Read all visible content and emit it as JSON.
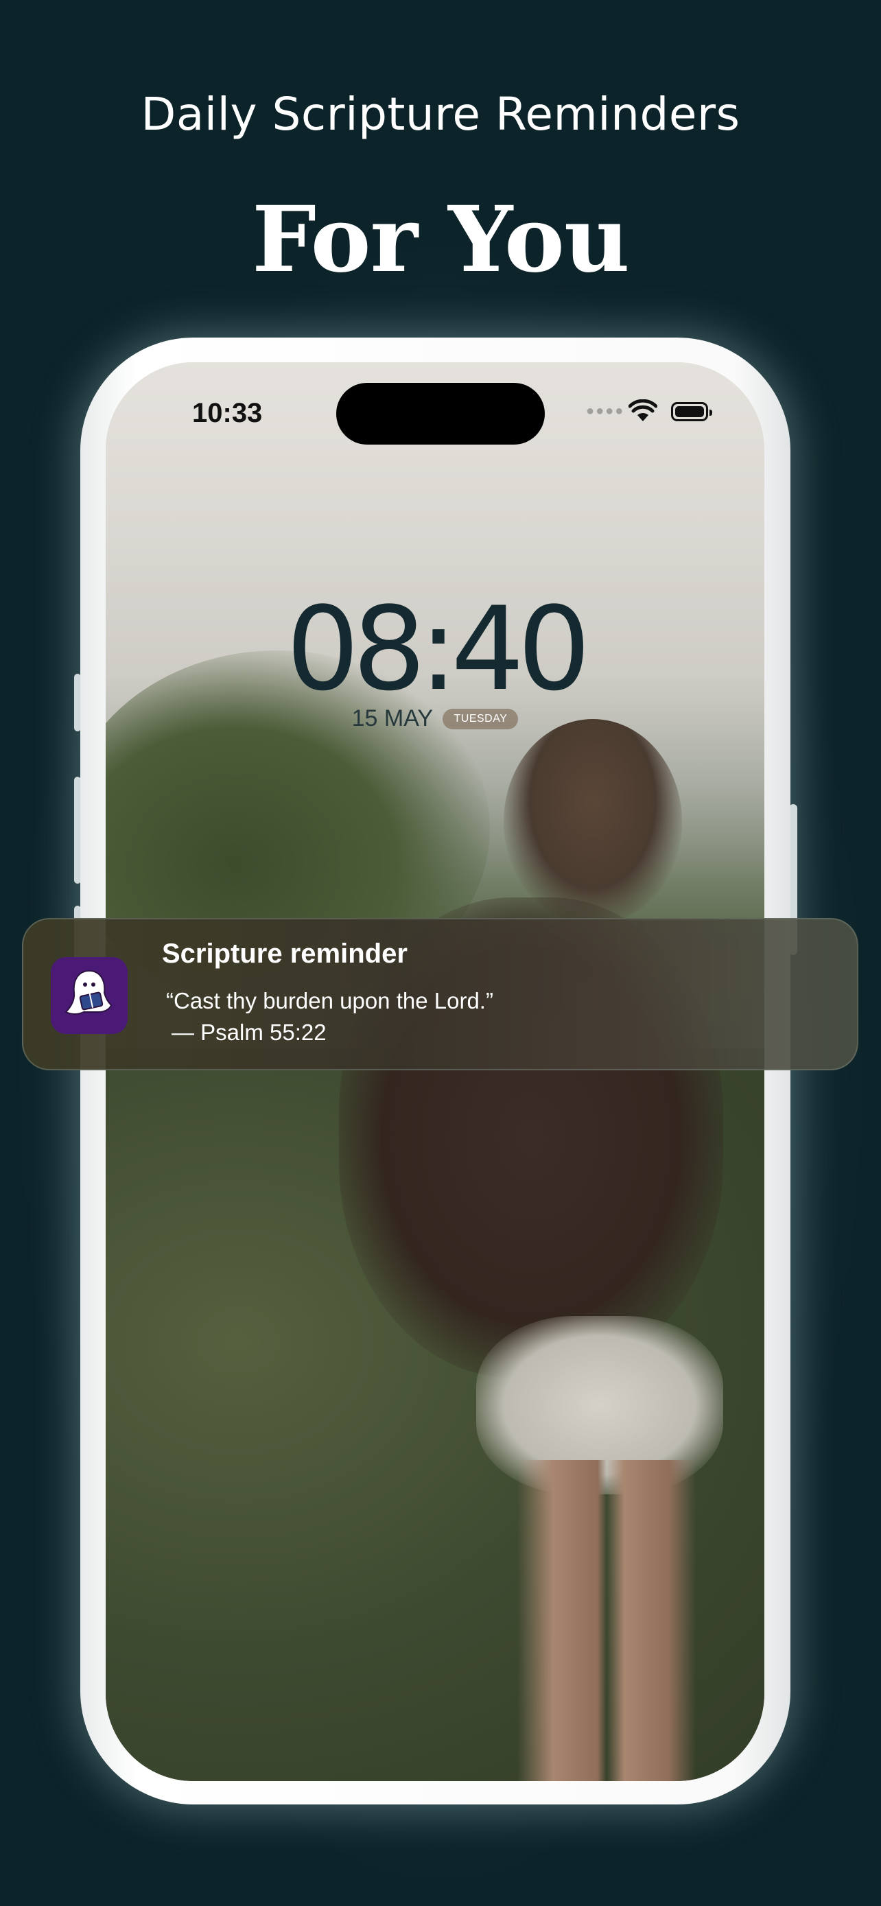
{
  "header": {
    "subtitle": "Daily Scripture Reminders",
    "title": "For You"
  },
  "status_bar": {
    "time": "10:33",
    "wifi_icon": "wifi-icon",
    "battery_icon": "battery-full-icon"
  },
  "lock_screen": {
    "clock": "08:40",
    "date": "15 MAY",
    "day": "TUESDAY"
  },
  "notification": {
    "app_icon": "bible-reading-mascot-icon",
    "app_icon_color": "#4b1a76",
    "title": "Scripture reminder",
    "quote": "“Cast thy burden upon the Lord.”",
    "reference": "— Psalm 55:22"
  }
}
